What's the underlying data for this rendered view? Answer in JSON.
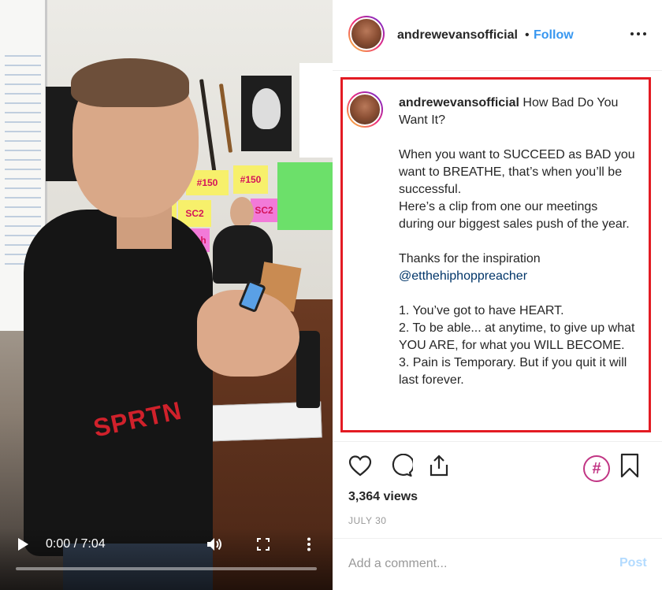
{
  "video": {
    "current_time": "0:00",
    "separator": "/",
    "duration": "7:04",
    "progress": 0.0,
    "shirt_logo": "SPRTN"
  },
  "post": {
    "username": "andrewevansofficial",
    "dot": "•",
    "follow_label": "Follow",
    "caption": {
      "username": "andrewevansofficial",
      "title": "How Bad Do You Want It?",
      "lines": [
        "When you want to SUCCEED as BAD you want to BREATHE, that’s when you’ll be successful.",
        "Here’s a clip from one our meetings during our biggest sales push of the year."
      ],
      "thanks": "Thanks for the inspiration",
      "mention": "@etthehiphoppreacher",
      "points": [
        "1. You’ve got to have HEART.",
        "2. To be able... at anytime, to give up what YOU ARE, for what you WILL BECOME.",
        "3. Pain is Temporary. But if you quit it will last forever."
      ]
    },
    "hashtag_symbol": "#",
    "views": "3,364 views",
    "date": "JULY 30",
    "comment_placeholder": "Add a comment...",
    "post_label": "Post"
  },
  "colors": {
    "follow": "#3897f0",
    "highlight_border": "#e31b23",
    "mention": "#003569",
    "post_disabled": "#b3dbff",
    "hashtag": "#c13584"
  },
  "icons": [
    "play-icon",
    "volume-icon",
    "fullscreen-icon",
    "more-vertical-icon",
    "more-horizontal-icon",
    "heart-icon",
    "comment-icon",
    "share-icon",
    "hashtag-icon",
    "bookmark-icon"
  ]
}
